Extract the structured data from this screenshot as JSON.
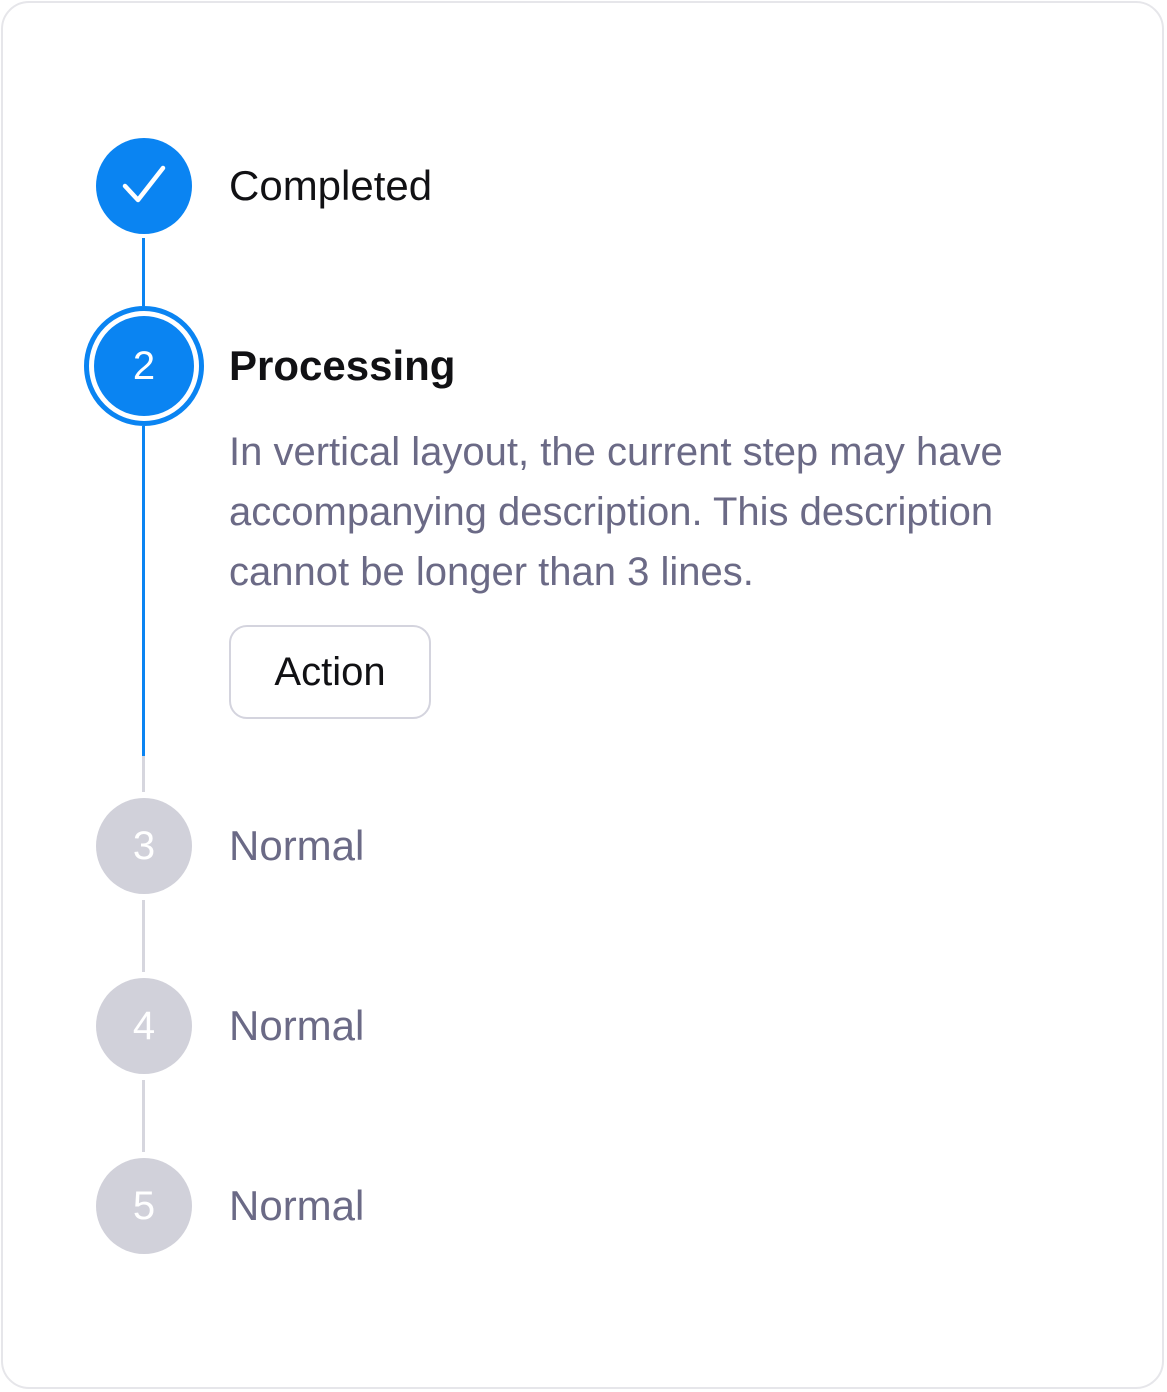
{
  "colors": {
    "accent": "#0a84f2",
    "idle_circle": "#d1d1da",
    "idle_text": "#6b6a86",
    "title_text": "#111114"
  },
  "steps": [
    {
      "icon": "check-icon",
      "title": "Completed",
      "state": "completed"
    },
    {
      "number": "2",
      "title": "Processing",
      "state": "current",
      "description": "In vertical layout, the current step may have accompanying description. This description cannot be longer than 3 lines.",
      "action_label": "Action"
    },
    {
      "number": "3",
      "title": "Normal",
      "state": "normal"
    },
    {
      "number": "4",
      "title": "Normal",
      "state": "normal"
    },
    {
      "number": "5",
      "title": "Normal",
      "state": "normal"
    }
  ]
}
